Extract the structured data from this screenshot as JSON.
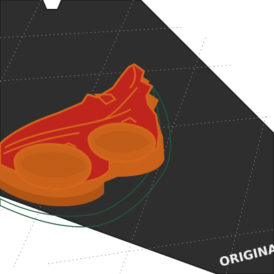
{
  "viewport": {
    "background": "#ffffff",
    "bed_color": "#2e2e2e",
    "bed_edge_color": "#1e1e1e",
    "grid_color": "#8a8a8a",
    "brand_text": "ORIGINA"
  },
  "model": {
    "perimeter_color": "#d2661c",
    "top_infill_color": "#c4261d",
    "wall_shade_color": "#9a4a12",
    "skirt_color": "#1f5a3c"
  }
}
